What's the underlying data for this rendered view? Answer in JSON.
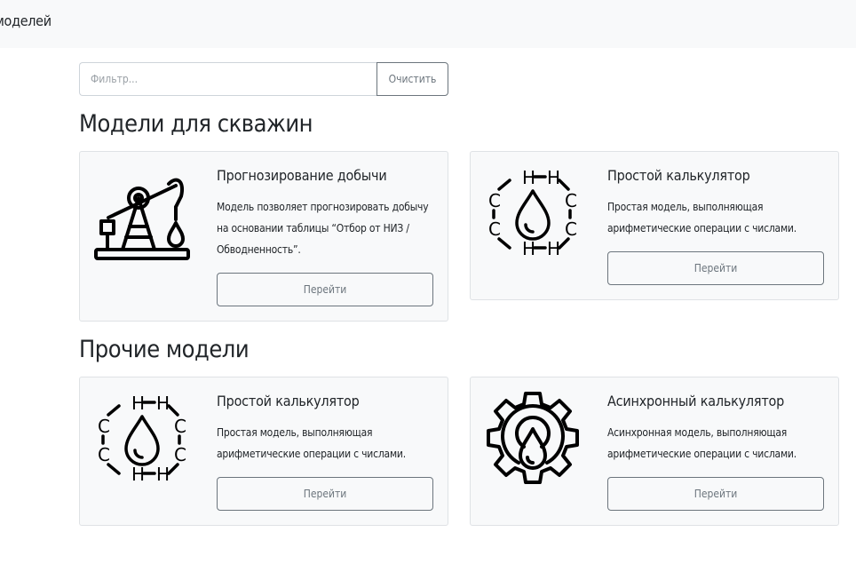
{
  "header": {
    "title": "моделей"
  },
  "filter": {
    "placeholder": "Фильтр...",
    "clear_label": "Очистить"
  },
  "sections": [
    {
      "title": "Модели для скважин",
      "cards": [
        {
          "title": "Прогнозирование добычи",
          "description": "Модель позволяет прогнозировать добычу на основании таблицы “Отбор от НИЗ / Обводненность”.",
          "button_label": "Перейти",
          "icon": "oil-pump-icon"
        },
        {
          "title": "Простой калькулятор",
          "description": "Простая модель, выполняющая арифметические операции с числами.",
          "button_label": "Перейти",
          "icon": "hydrocarbon-drop-icon"
        }
      ]
    },
    {
      "title": "Прочие модели",
      "cards": [
        {
          "title": "Простой калькулятор",
          "description": "Простая модель, выполняющая арифметические операции с числами.",
          "button_label": "Перейти",
          "icon": "hydrocarbon-drop-icon"
        },
        {
          "title": "Асинхронный калькулятор",
          "description": "Асинхронная модель, выполняющая арифметические операции с числами.",
          "button_label": "Перейти",
          "icon": "gear-drop-icon"
        }
      ]
    }
  ],
  "colors": {
    "card_bg": "#f8f9fa",
    "button_outline": "#6c757d",
    "topbar_bg": "#f8f9fa"
  }
}
